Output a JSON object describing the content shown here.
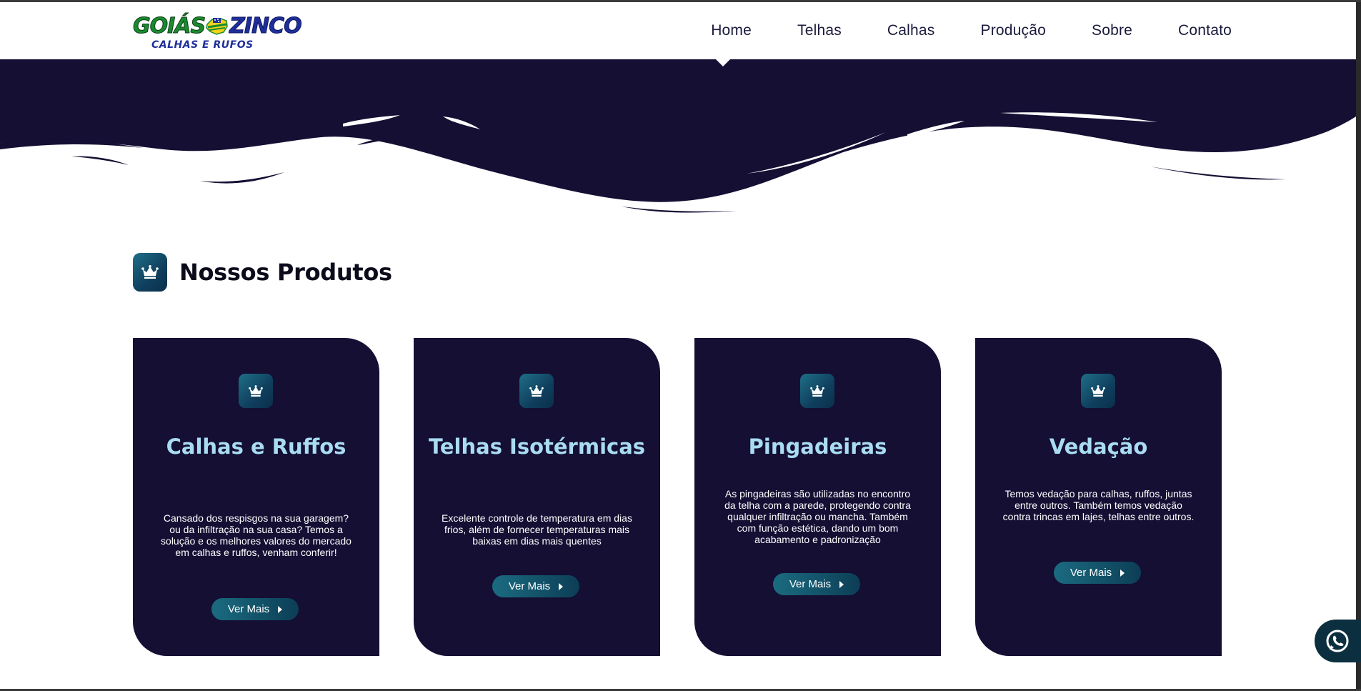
{
  "header": {
    "logo": {
      "top_left": "GOIÁS",
      "top_right": "ZINCO",
      "bottom": "CALHAS E RUFOS"
    },
    "nav": [
      {
        "label": "Home",
        "active": true
      },
      {
        "label": "Telhas"
      },
      {
        "label": "Calhas"
      },
      {
        "label": "Produção"
      },
      {
        "label": "Sobre"
      },
      {
        "label": "Contato"
      }
    ]
  },
  "section": {
    "title": "Nossos Produtos",
    "icon": "crown-icon"
  },
  "cards": [
    {
      "title": "Calhas e Ruffos",
      "description": "Cansado dos respisgos na sua garagem? ou da infiltração na sua casa? Temos a solução e os melhores valores do mercado em calhas e ruffos, venham conferir!",
      "button": "Ver Mais",
      "icon": "crown-icon"
    },
    {
      "title": "Telhas Isotérmicas",
      "description": "Excelente controle de temperatura em dias frios, além de fornecer temperaturas mais baixas em dias mais quentes",
      "button": "Ver Mais",
      "icon": "crown-icon"
    },
    {
      "title": "Pingadeiras",
      "description": "As pingadeiras são utilizadas no encontro da telha com a parede, protegendo contra qualquer infiltração ou mancha. Também com função estética, dando um bom acabamento e padronização",
      "button": "Ver Mais",
      "icon": "crown-icon"
    },
    {
      "title": "Vedação",
      "description": "Temos vedação para calhas, ruffos, juntas entre outros. Também temos vedação contra trincas em lajes, telhas entre outros.",
      "button": "Ver Mais",
      "icon": "crown-icon"
    }
  ],
  "floating": {
    "icon": "whatsapp-icon"
  },
  "colors": {
    "dark_navy": "#140f33",
    "accent_teal": "#1b6b80",
    "card_title": "#a9dcf2"
  }
}
